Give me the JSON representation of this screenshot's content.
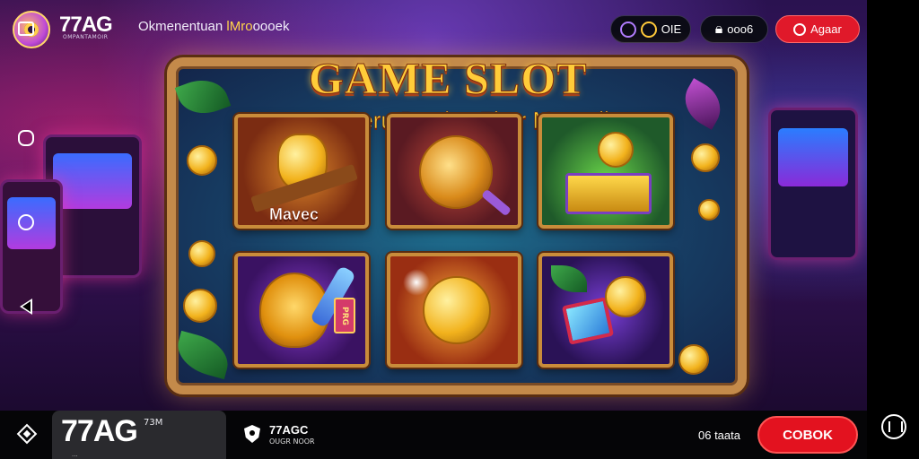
{
  "header": {
    "brand": "77AG",
    "brand_sub": "OMPANTAMOIR",
    "tagline_main": "Okmenentuan",
    "tagline_highlight": "lMro",
    "tagline_tail": "oooek",
    "coin_pill_label": "OIE",
    "user_pill_label": "ooo6",
    "cta_label": "Agaar"
  },
  "hero": {
    "title": "GAME SLOT",
    "subtitle": "Seru Berdys Fitur Menarik",
    "tile_label": "Mavec",
    "tile_ribbon": "PRG"
  },
  "bottombar": {
    "brand": "77AG",
    "small": "73M",
    "tiny": "...",
    "app_name": "77AGC",
    "app_sub": "OUGR NOOR",
    "promo_text": "06 taata",
    "cta_label": "COBOK"
  },
  "icons": {
    "coin": "coin-icon",
    "lock": "lock-icon",
    "diamond": "diamond-icon",
    "shield": "shield-icon",
    "menu": "menu-icon"
  },
  "colors": {
    "accent_red": "#e3121f",
    "gold": "#ffcc39",
    "frame_gold": "#c48a4a"
  }
}
